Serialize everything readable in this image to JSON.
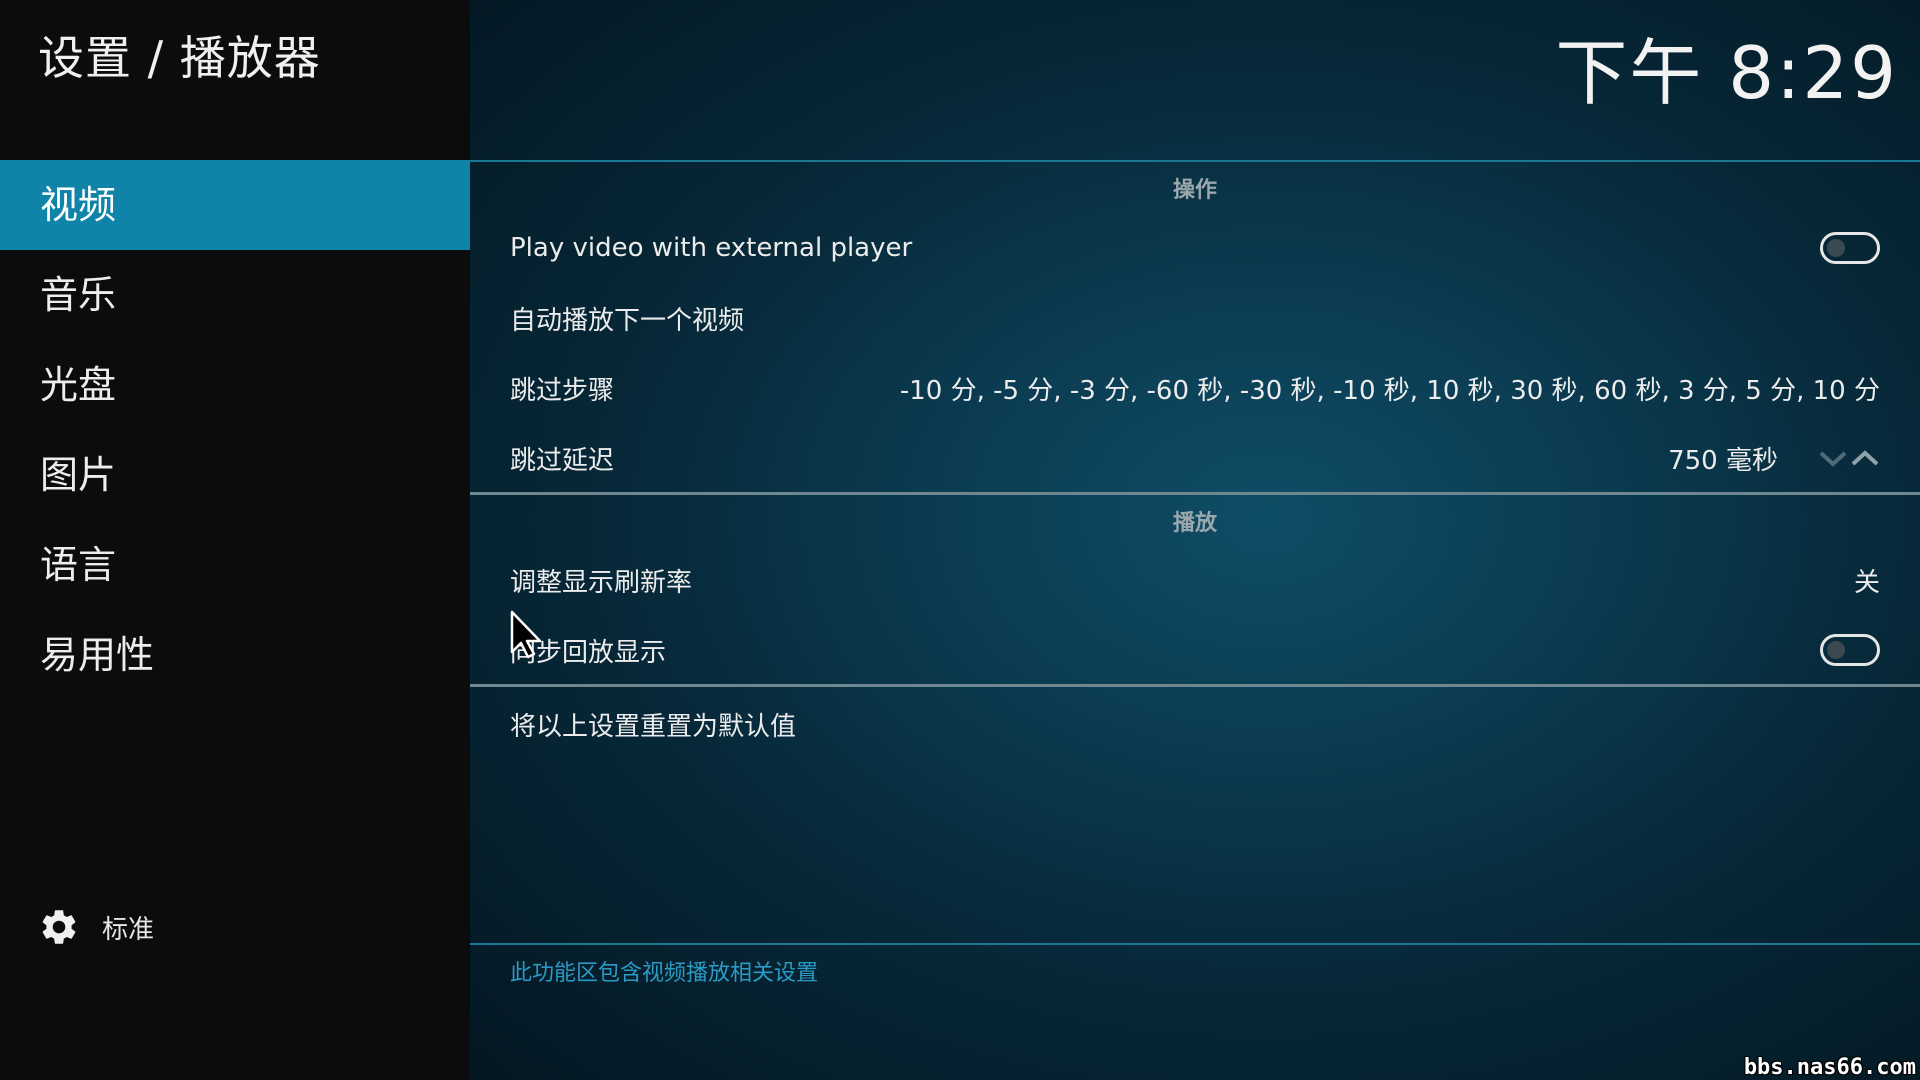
{
  "breadcrumb": "设置 / 播放器",
  "clock": "下午 8:29",
  "sidebar": {
    "items": [
      {
        "label": "视频",
        "active": true
      },
      {
        "label": "音乐",
        "active": false
      },
      {
        "label": "光盘",
        "active": false
      },
      {
        "label": "图片",
        "active": false
      },
      {
        "label": "语言",
        "active": false
      },
      {
        "label": "易用性",
        "active": false
      }
    ],
    "settings_level": {
      "icon": "gear-icon",
      "label": "标准"
    }
  },
  "sections": {
    "actions": {
      "header": "操作",
      "rows": {
        "external_player": {
          "label": "Play video with external player",
          "toggle_on": false
        },
        "autoplay_next": {
          "label": "自动播放下一个视频"
        },
        "skip_steps": {
          "label": "跳过步骤",
          "value": "-10 分, -5 分, -3 分, -60 秒, -30 秒, -10 秒, 10 秒, 30 秒, 60 秒, 3 分, 5 分, 10 分"
        },
        "skip_delay": {
          "label": "跳过延迟",
          "value": "750 毫秒"
        }
      }
    },
    "playback": {
      "header": "播放",
      "rows": {
        "refresh_rate": {
          "label": "调整显示刷新率",
          "value": "关"
        },
        "sync_playback": {
          "label": "同步回放显示",
          "toggle_on": false
        }
      }
    }
  },
  "reset_label": "将以上设置重置为默认值",
  "description": "此功能区包含视频播放相关设置",
  "watermark": "bbs.nas66.com",
  "colors": {
    "accent": "#0f84a8",
    "description_text": "#2b9ac4"
  }
}
